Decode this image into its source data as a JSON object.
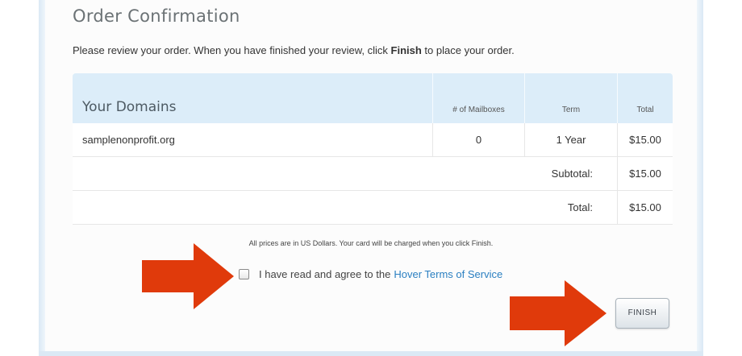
{
  "page": {
    "title": "Order Confirmation",
    "instructions_before": "Please review your order. When you have finished your review, click ",
    "instructions_bold": "Finish",
    "instructions_after": " to place your order."
  },
  "table": {
    "headers": {
      "domains": "Your Domains",
      "mailboxes": "# of Mailboxes",
      "term": "Term",
      "total": "Total"
    },
    "rows": [
      {
        "domain": "samplenonprofit.org",
        "mailboxes": "0",
        "term": "1 Year",
        "total": "$15.00"
      }
    ],
    "subtotal_label": "Subtotal:",
    "subtotal_value": "$15.00",
    "total_label": "Total:",
    "total_value": "$15.00"
  },
  "note": "All prices are in US Dollars. Your card will be charged when you click Finish.",
  "agreement": {
    "checked": false,
    "label": "I have read and agree to the",
    "link": "Hover Terms of Service"
  },
  "finish_label": "FINISH",
  "colors": {
    "arrow": "#e03a0b",
    "header_bg": "#dcedf9",
    "link": "#2a7fc1"
  },
  "icons": {
    "arrow_left": "arrow-right-icon",
    "arrow_right": "arrow-right-icon"
  }
}
